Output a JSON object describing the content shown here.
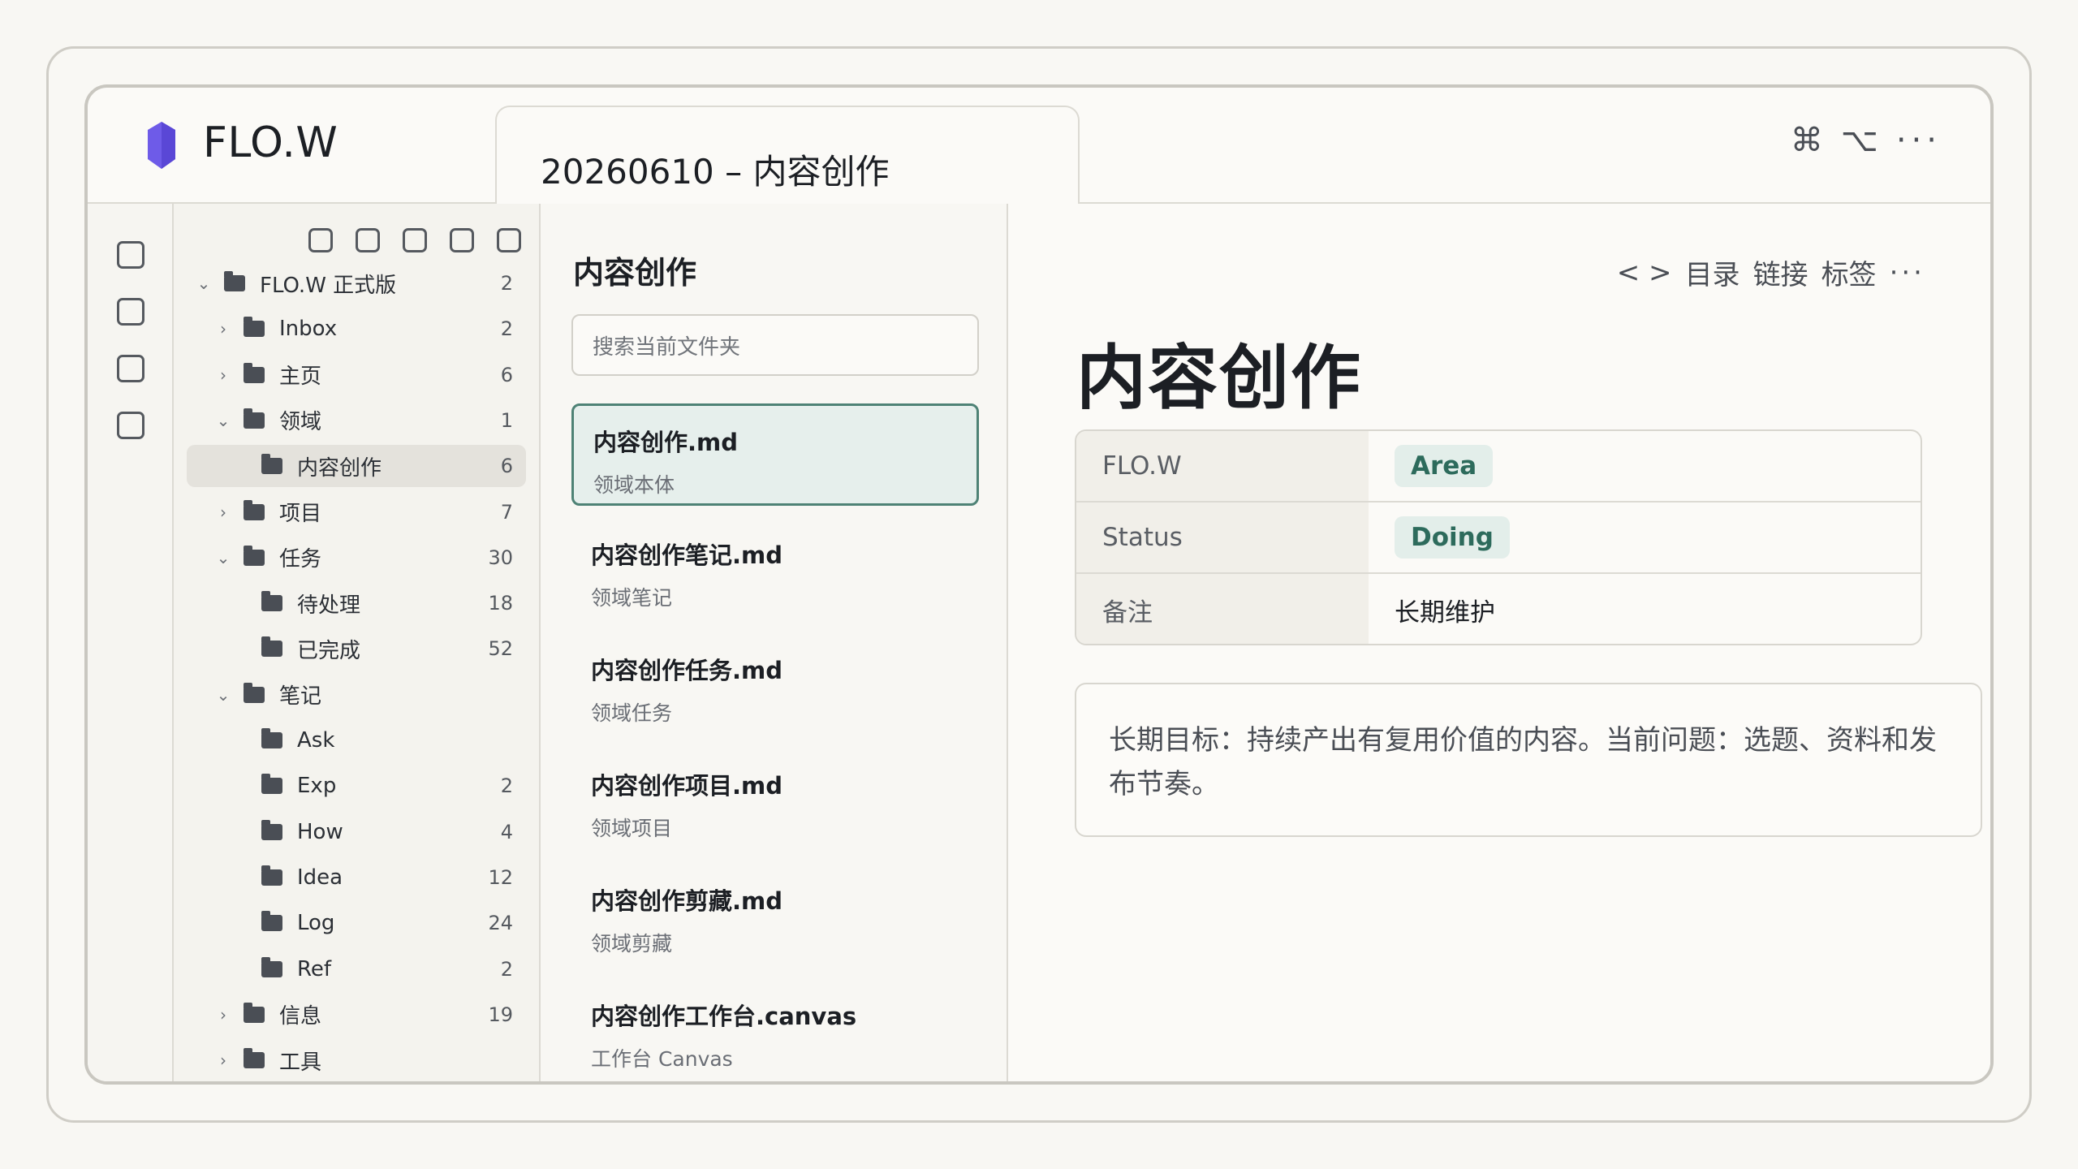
{
  "app": {
    "name": "FLO.W",
    "logo_color": "#6e5be8"
  },
  "tab": {
    "title": "20260610 – 内容创作"
  },
  "title_actions": [
    "⌘",
    "⌥",
    "···"
  ],
  "ribbon": {
    "icons": [
      "checkbox-icon",
      "checkbox-icon",
      "checkbox-icon",
      "checkbox-icon"
    ]
  },
  "tree": {
    "toolbar_icons": [
      "new-note-icon",
      "new-folder-icon",
      "sort-icon",
      "collapse-icon",
      "reveal-icon"
    ],
    "items": [
      {
        "label": "FLO.W 正式版",
        "count": "2",
        "chevron": "⌄",
        "depth": 0
      },
      {
        "label": "Inbox",
        "count": "2",
        "chevron": "›",
        "depth": 1
      },
      {
        "label": "主页",
        "count": "6",
        "chevron": "›",
        "depth": 1
      },
      {
        "label": "领域",
        "count": "1",
        "chevron": "⌄",
        "depth": 1
      },
      {
        "label": "内容创作",
        "count": "6",
        "chevron": "",
        "depth": 2,
        "selected": true
      },
      {
        "label": "项目",
        "count": "7",
        "chevron": "›",
        "depth": 1
      },
      {
        "label": "任务",
        "count": "30",
        "chevron": "⌄",
        "depth": 1
      },
      {
        "label": "待处理",
        "count": "18",
        "chevron": "",
        "depth": 2
      },
      {
        "label": "已完成",
        "count": "52",
        "chevron": "",
        "depth": 2
      },
      {
        "label": "笔记",
        "count": "",
        "chevron": "⌄",
        "depth": 1
      },
      {
        "label": "Ask",
        "count": "",
        "chevron": "",
        "depth": 2
      },
      {
        "label": "Exp",
        "count": "2",
        "chevron": "",
        "depth": 2
      },
      {
        "label": "How",
        "count": "4",
        "chevron": "",
        "depth": 2
      },
      {
        "label": "Idea",
        "count": "12",
        "chevron": "",
        "depth": 2
      },
      {
        "label": "Log",
        "count": "24",
        "chevron": "",
        "depth": 2
      },
      {
        "label": "Ref",
        "count": "2",
        "chevron": "",
        "depth": 2
      },
      {
        "label": "信息",
        "count": "19",
        "chevron": "›",
        "depth": 1
      },
      {
        "label": "工具",
        "count": "",
        "chevron": "›",
        "depth": 1
      }
    ]
  },
  "filelist": {
    "title": "内容创作",
    "search_placeholder": "搜索当前文件夹",
    "files": [
      {
        "name": "内容创作.md",
        "sub": "领域本体",
        "active": true
      },
      {
        "name": "内容创作笔记.md",
        "sub": "领域笔记"
      },
      {
        "name": "内容创作任务.md",
        "sub": "领域任务"
      },
      {
        "name": "内容创作项目.md",
        "sub": "领域项目"
      },
      {
        "name": "内容创作剪藏.md",
        "sub": "领域剪藏"
      },
      {
        "name": "内容创作工作台.canvas",
        "sub": "工作台 Canvas"
      }
    ]
  },
  "content": {
    "view_actions": [
      "< >",
      "目录",
      "链接",
      "标签",
      "···"
    ],
    "title": "内容创作",
    "properties": [
      {
        "key": "FLO.W",
        "value": "Area",
        "tag": true
      },
      {
        "key": "Status",
        "value": "Doing",
        "tag": true
      },
      {
        "key": "备注",
        "value": "长期维护",
        "tag": false
      }
    ],
    "callout": "长期目标：持续产出有复用价值的内容。当前问题：选题、资料和发布节奏。"
  }
}
